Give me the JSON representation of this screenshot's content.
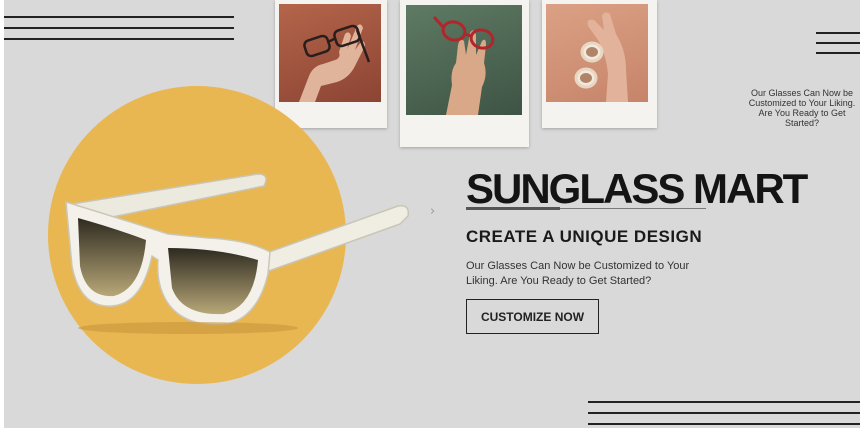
{
  "hero": {
    "brand": "SUNGLASS MART",
    "subtitle": "CREATE A UNIQUE DESIGN",
    "description": "Our Glasses Can Now be Customized to Your Liking. Are You Ready to Get Started?",
    "cta_label": "CUSTOMIZE NOW"
  },
  "side_note": "Our Glasses Can Now be Customized to Your Liking. Are You Ready to Get Started?",
  "icons": {
    "menu": "hamburger-menu-icon",
    "next": "chevron-right-icon",
    "next_glyph": "›"
  },
  "colors": {
    "background": "#d9d9d9",
    "circle": "#e8b751",
    "text": "#141414",
    "polaroid_frame": "#f4f3ef"
  }
}
